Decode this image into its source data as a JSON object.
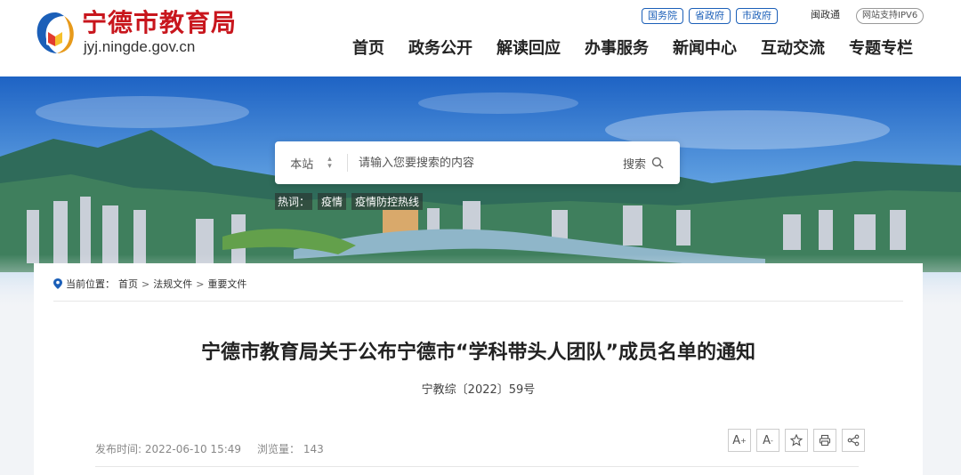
{
  "site": {
    "title": "宁德市教育局",
    "domain": "jyj.ningde.gov.cn",
    "brand_red": "#c8161d",
    "brand_blue": "#1b5fb8"
  },
  "top_links": [
    "国务院",
    "省政府",
    "市政府"
  ],
  "minzhengtong": "闽政通",
  "ipv6": "网站支持IPV6",
  "nav": [
    "首页",
    "政务公开",
    "解读回应",
    "办事服务",
    "新闻中心",
    "互动交流",
    "专题专栏"
  ],
  "search": {
    "scope": "本站",
    "placeholder": "请输入您要搜索的内容",
    "button": "搜索",
    "icon": "search-icon"
  },
  "hot": {
    "label": "热词：",
    "tags": [
      "疫情",
      "疫情防控热线"
    ]
  },
  "breadcrumb": {
    "label": "当前位置：",
    "items": [
      "首页",
      "法规文件",
      "重要文件"
    ],
    "separator": ">"
  },
  "article": {
    "title": "宁德市教育局关于公布宁德市“学科带头人团队”成员名单的通知",
    "doc_no": "宁教综〔2022〕59号",
    "publish_label": "发布时间:",
    "publish_time": "2022-06-10 15:49",
    "views_label": "浏览量：",
    "views": "143"
  },
  "tools": [
    "A+",
    "A-",
    "star-icon",
    "print-icon",
    "share-icon"
  ]
}
